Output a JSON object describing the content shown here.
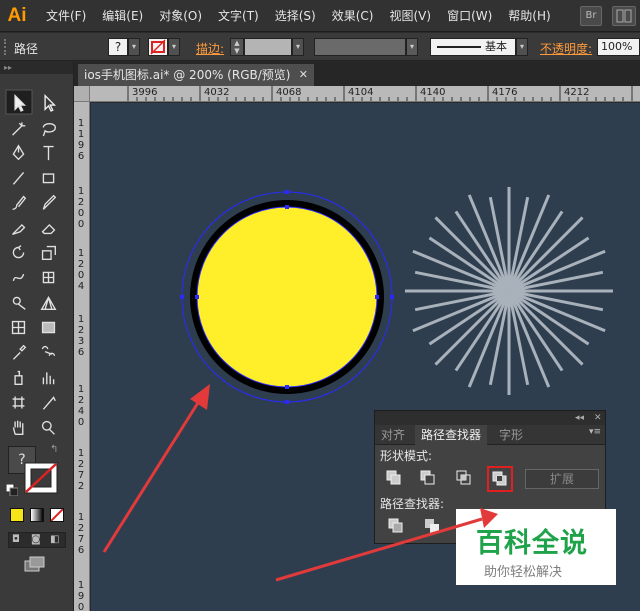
{
  "app": {
    "logo": "Ai"
  },
  "menu": [
    "文件(F)",
    "编辑(E)",
    "对象(O)",
    "文字(T)",
    "选择(S)",
    "效果(C)",
    "视图(V)",
    "窗口(W)",
    "帮助(H)"
  ],
  "menu_right": {
    "bridge_label": "Br"
  },
  "control_bar": {
    "selection_type": "路径",
    "fill_symbol": "?",
    "stroke_label": "描边:",
    "brush_label": "基本",
    "opacity_label": "不透明度:",
    "opacity_value": "100%"
  },
  "document_tab": {
    "title": "ios手机图标.ai* @ 200% (RGB/预览)",
    "close": "✕"
  },
  "ruler": {
    "horizontal": [
      "3996",
      "4032",
      "4068",
      "4104",
      "4140",
      "4176",
      "4212"
    ],
    "vertical": [
      "1196",
      "1200",
      "1204",
      "1236",
      "1240",
      "1272",
      "1276",
      "1908",
      "1912",
      "1980"
    ]
  },
  "toolbox": {
    "fill_stroke_indicator": "?",
    "tools": [
      "selection-tool",
      "direct-selection-tool",
      "magic-wand-tool",
      "lasso-tool",
      "pen-tool",
      "type-tool",
      "line-tool",
      "rectangle-tool",
      "paintbrush-tool",
      "pencil-tool",
      "blob-brush-tool",
      "eraser-tool",
      "rotate-tool",
      "scale-tool",
      "warp-tool",
      "free-transform-tool",
      "shape-builder-tool",
      "perspective-grid-tool",
      "mesh-tool",
      "gradient-tool",
      "eyedropper-tool",
      "blend-tool",
      "symbol-sprayer-tool",
      "column-graph-tool",
      "artboard-tool",
      "slice-tool",
      "hand-tool",
      "zoom-tool"
    ]
  },
  "pathfinder_panel": {
    "tabs": [
      "对齐",
      "路径查找器",
      "字形"
    ],
    "active_tab": "路径查找器",
    "shape_modes_label": "形状模式:",
    "expand_label": "扩展",
    "pathfinders_label": "路径查找器:",
    "collapse": "◂◂",
    "close": "✕"
  },
  "watermark": {
    "title": "百科全说",
    "subtitle": "助你轻松解决"
  },
  "colors": {
    "canvas": "#2e3e4f",
    "circle_fill": "#ffee2a",
    "circle_stroke": "#000000",
    "selection": "#2a2aff",
    "burst": "#a9b1bb",
    "arrow": "#e23a3a",
    "highlight_box": "#e02020",
    "watermark_green": "#1fa34a",
    "accent_orange": "#ff9a00"
  }
}
